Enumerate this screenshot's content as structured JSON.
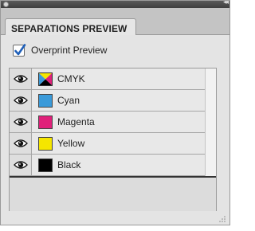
{
  "panel": {
    "tab_label": "SEPARATIONS PREVIEW"
  },
  "overprint": {
    "label": "Overprint Preview",
    "checked": true
  },
  "separations": [
    {
      "label": "CMYK",
      "swatch": "cmyk",
      "visible": true
    },
    {
      "label": "Cyan",
      "swatch": "#3a9ad9",
      "visible": true
    },
    {
      "label": "Magenta",
      "swatch": "#e0207a",
      "visible": true
    },
    {
      "label": "Yellow",
      "swatch": "#f5e600",
      "visible": true
    },
    {
      "label": "Black",
      "swatch": "#000000",
      "visible": true
    }
  ],
  "colors": {
    "check_mark": "#1f5fb8"
  },
  "icons": {
    "visibility": "eye-icon",
    "close": "close-dot-icon",
    "collapse": "double-chevron-icon",
    "resize": "resize-grip-icon"
  }
}
